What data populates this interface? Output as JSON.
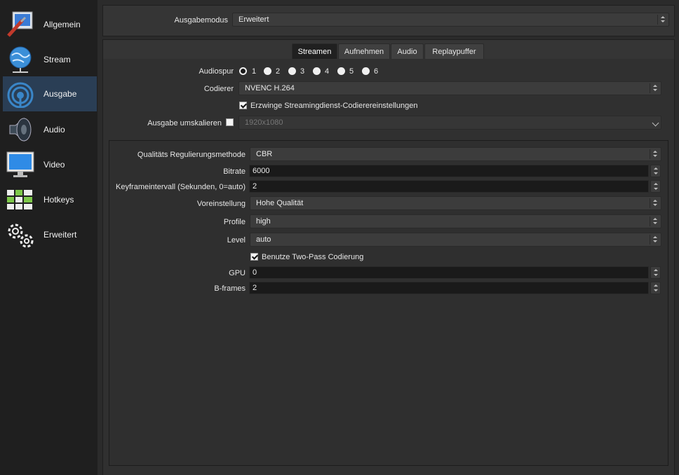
{
  "sidebar": {
    "items": [
      {
        "label": "Allgemein",
        "icon": "general-settings-icon"
      },
      {
        "label": "Stream",
        "icon": "globe-network-icon"
      },
      {
        "label": "Ausgabe",
        "icon": "broadcast-antenna-icon",
        "active": true
      },
      {
        "label": "Audio",
        "icon": "speaker-icon"
      },
      {
        "label": "Video",
        "icon": "monitor-icon"
      },
      {
        "label": "Hotkeys",
        "icon": "keyboard-icon"
      },
      {
        "label": "Erweitert",
        "icon": "gears-icon"
      }
    ]
  },
  "output_mode": {
    "label": "Ausgabemodus",
    "value": "Erweitert"
  },
  "tabs": [
    {
      "label": "Streamen",
      "active": true
    },
    {
      "label": "Aufnehmen"
    },
    {
      "label": "Audio"
    },
    {
      "label": "Replaypuffer"
    }
  ],
  "streaming": {
    "audio_track": {
      "label": "Audiospur",
      "options": [
        "1",
        "2",
        "3",
        "4",
        "5",
        "6"
      ],
      "selected": "1"
    },
    "encoder": {
      "label": "Codierer",
      "value": "NVENC H.264"
    },
    "enforce_settings": {
      "label": "Erzwinge Streamingdienst-Codierereinstellungen",
      "checked": true
    },
    "rescale": {
      "label": "Ausgabe umskalieren",
      "checked": false,
      "value": "1920x1080"
    }
  },
  "encoder_settings": {
    "rate_control": {
      "label": "Qualitäts Regulierungsmethode",
      "value": "CBR"
    },
    "bitrate": {
      "label": "Bitrate",
      "value": "6000"
    },
    "keyframe": {
      "label": "Keyframeintervall (Sekunden, 0=auto)",
      "value": "2"
    },
    "preset": {
      "label": "Voreinstellung",
      "value": "Hohe Qualität"
    },
    "profile": {
      "label": "Profile",
      "value": "high"
    },
    "level": {
      "label": "Level",
      "value": "auto"
    },
    "two_pass": {
      "label": "Benutze Two-Pass Codierung",
      "checked": true
    },
    "gpu": {
      "label": "GPU",
      "value": "0"
    },
    "bframes": {
      "label": "B-frames",
      "value": "2"
    }
  },
  "colors": {
    "sidebar_bg": "#1f1f1f",
    "active_item": "#2a3e55",
    "panel_bg": "#353535"
  }
}
